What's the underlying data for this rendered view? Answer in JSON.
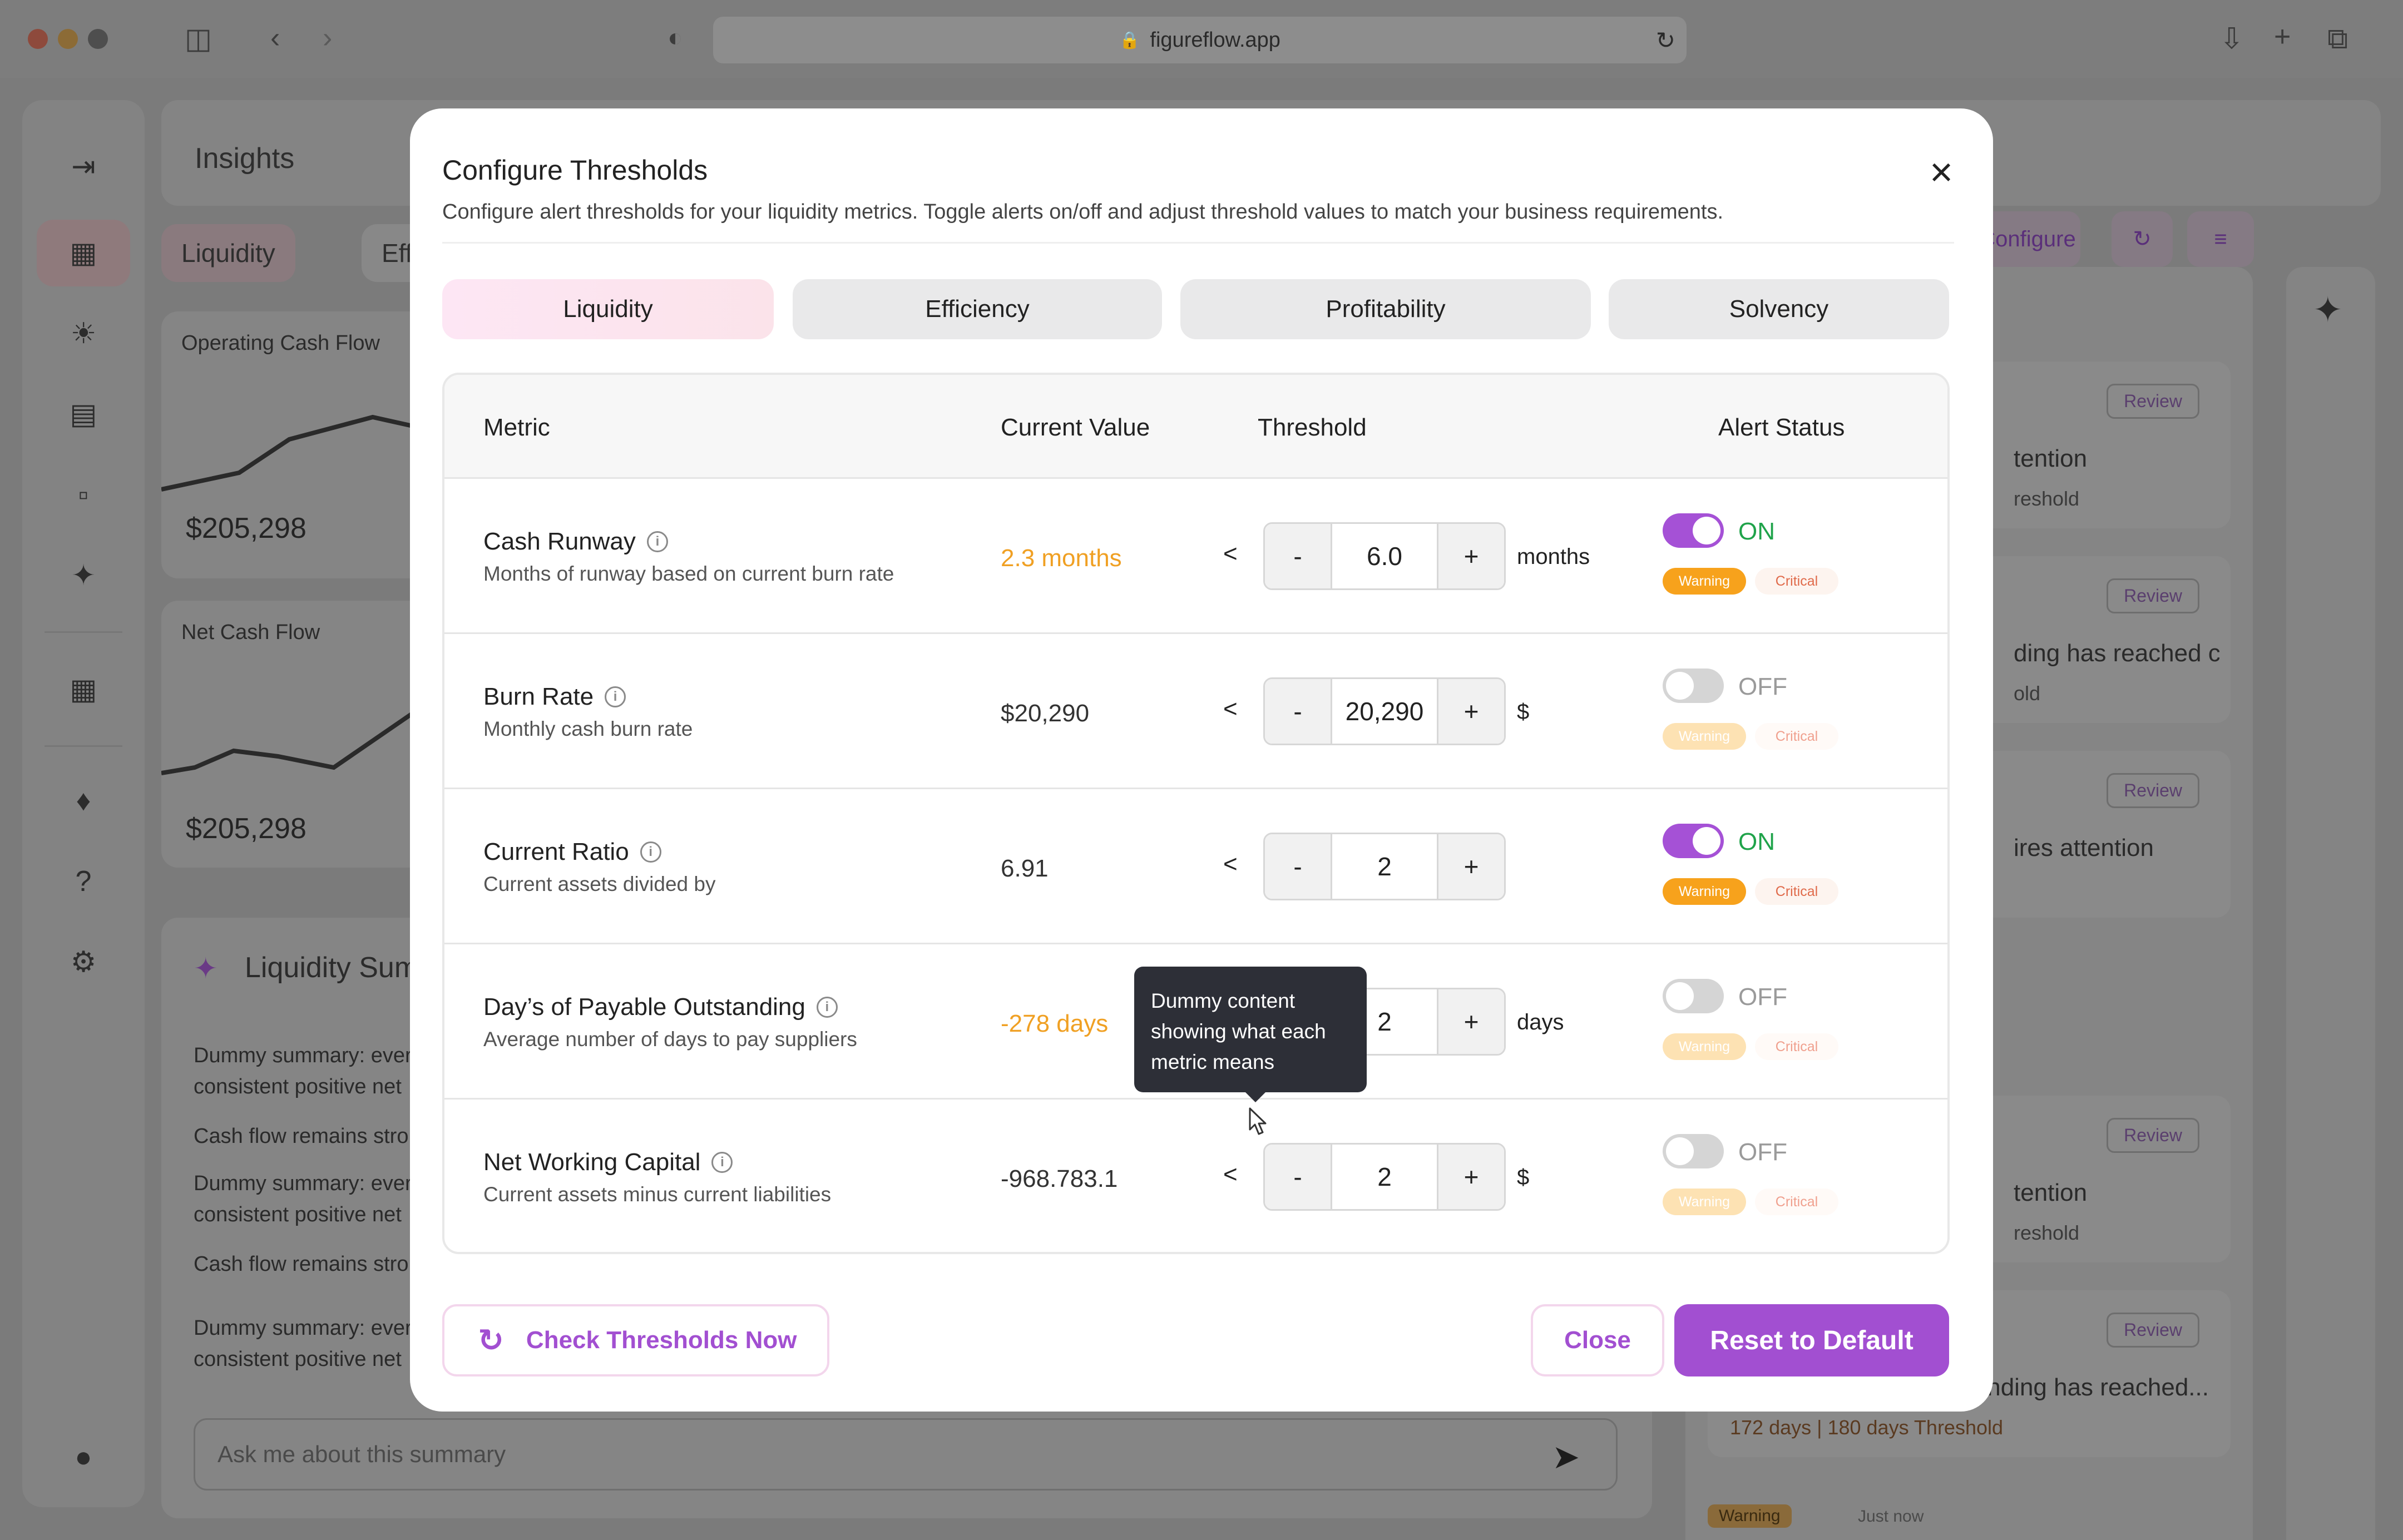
{
  "browser": {
    "url": "figureflow.app"
  },
  "background": {
    "page_title": "Insights",
    "chips": [
      "Liquidity",
      "Efficie"
    ],
    "cards": [
      {
        "label": "Operating Cash Flow",
        "value": "$205,298"
      },
      {
        "label": "Net Cash Flow",
        "value": "$205,298"
      }
    ],
    "summary": {
      "title": "Liquidity Sum",
      "lines": [
        "Dummy summary: ever consistent positive net",
        "Cash flow remains stro",
        "Dummy summary: ever consistent positive net",
        "Cash flow remains stro",
        "Dummy summary: ever consistent positive net"
      ],
      "ask_placeholder": "Ask me about this summary"
    },
    "toolbar": {
      "configure_label": "Configure"
    },
    "review_label": "Review",
    "alerts": [
      {
        "text": "tention",
        "sub": "reshold"
      },
      {
        "text": "ding has reached cri...",
        "sub": "old"
      },
      {
        "text": "ires attention",
        "sub": ""
      },
      {
        "text": "tention",
        "sub": "reshold"
      },
      {
        "text": "Days of Payable Outstanding has reached...",
        "sub": "172 days  |  180 days Threshold"
      }
    ],
    "footer_badge": "Warning",
    "footer_time": "Just now"
  },
  "modal": {
    "title": "Configure Thresholds",
    "subtitle": "Configure alert thresholds for your liquidity metrics. Toggle alerts on/off and adjust threshold values to match your business requirements.",
    "tabs": [
      "Liquidity",
      "Efficiency",
      "Profitability",
      "Solvency"
    ],
    "active_tab": "Liquidity",
    "columns": {
      "metric": "Metric",
      "current": "Current Value",
      "threshold": "Threshold",
      "status": "Alert Status"
    },
    "rows": [
      {
        "name": "Cash Runway",
        "desc": "Months of runway based on current burn rate",
        "current": "2.3 months",
        "current_warn": true,
        "op": "<",
        "value": "6.0",
        "unit": "months",
        "enabled": true,
        "state": "ON"
      },
      {
        "name": "Burn Rate",
        "desc": "Monthly cash burn rate",
        "current": "$20,290",
        "current_warn": false,
        "op": "<",
        "value": "20,290",
        "unit": "$",
        "enabled": false,
        "state": "OFF"
      },
      {
        "name": "Current Ratio",
        "desc": "Current assets divided by",
        "current": "6.91",
        "current_warn": false,
        "op": "<",
        "value": "2",
        "unit": "",
        "enabled": true,
        "state": "ON"
      },
      {
        "name": "Day’s of Payable  Outstanding",
        "desc": "Average number of days to pay suppliers",
        "current": "-278 days",
        "current_warn": true,
        "op": "<",
        "value": "2",
        "unit": "days",
        "enabled": false,
        "state": "OFF"
      },
      {
        "name": "Net Working Capital",
        "desc": "Current assets minus current liabilities",
        "current": "-968.783.1",
        "current_warn": false,
        "op": "<",
        "value": "2",
        "unit": "$",
        "enabled": false,
        "state": "OFF"
      }
    ],
    "stepper": {
      "minus": "-",
      "plus": "+"
    },
    "badges": {
      "warning": "Warning",
      "critical": "Critical"
    },
    "tooltip": "Dummy content showing what each metric means",
    "buttons": {
      "check": "Check  Thresholds Now",
      "close": "Close",
      "reset": "Reset to Default"
    },
    "colors": {
      "accent": "#a24fd1",
      "on": "#1fa34a",
      "warning": "#f7a21c",
      "warn_text": "#f0a023"
    }
  }
}
